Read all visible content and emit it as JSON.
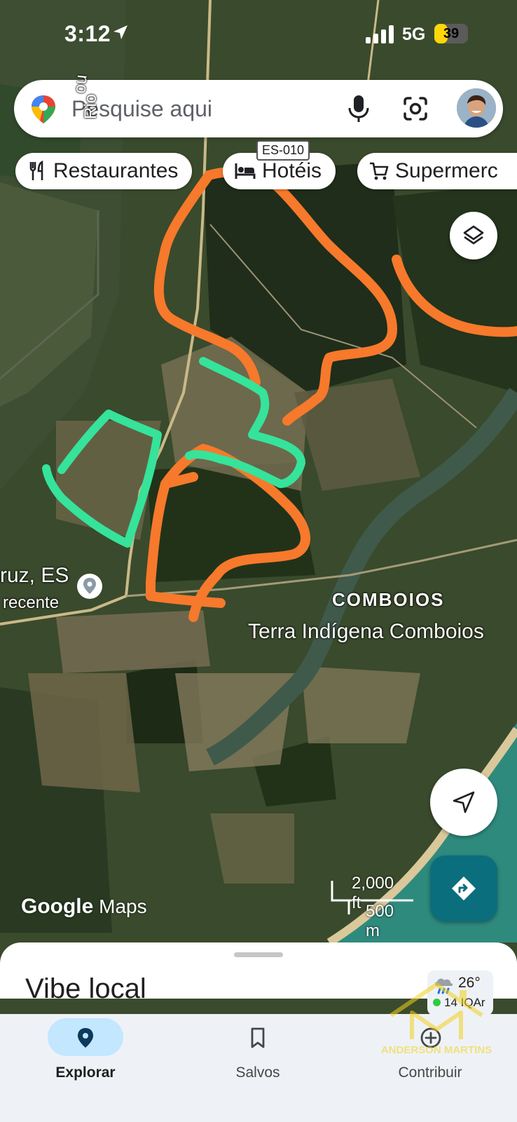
{
  "status_bar": {
    "time": "3:12",
    "network": "5G",
    "battery": "39",
    "battery_level": 0.39
  },
  "search": {
    "placeholder": "Pesquise aqui"
  },
  "chips": [
    {
      "label": "Restaurantes",
      "icon": "restaurant-icon"
    },
    {
      "label": "Hotéis",
      "icon": "hotel-icon"
    },
    {
      "label": "Supermerc",
      "icon": "cart-icon"
    }
  ],
  "map": {
    "road_label": "ES-010",
    "river_label": "Rio",
    "river_label_2": "no",
    "place_label": "ruz, ES",
    "place_sub": "recente",
    "area_title": "COMBOIOS",
    "area_subtitle": "Terra Indígena Comboios",
    "scale_ft": "2,000 ft",
    "scale_m": "500 m",
    "logo_google": "Google",
    "logo_maps": "Maps",
    "colors": {
      "orange_annotation": "#f7792b",
      "green_annotation": "#36e39a",
      "directions_button": "#0b6e7c"
    }
  },
  "sheet": {
    "title": "Vibe local",
    "weather": {
      "temp": "26°",
      "aqi": "14 IQAr",
      "icon": "weather-rain-cloud-icon"
    }
  },
  "nav": [
    {
      "label": "Explorar",
      "icon": "explore-pin-icon",
      "active": true
    },
    {
      "label": "Salvos",
      "icon": "bookmark-icon",
      "active": false
    },
    {
      "label": "Contribuir",
      "icon": "plus-circle-icon",
      "active": false
    }
  ],
  "watermark": {
    "text": "ANDERSON MARTINS",
    "icon": "house-m-logo-icon"
  }
}
